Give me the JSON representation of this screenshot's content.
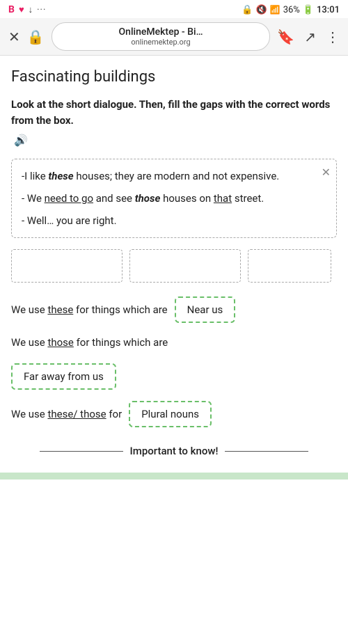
{
  "statusBar": {
    "leftIcons": [
      "B",
      "♥",
      "↓",
      "···"
    ],
    "battery": "36%",
    "time": "13:01",
    "signal": "●●●",
    "wifi": "📶"
  },
  "browser": {
    "urlTitle": "OnlineMektep - Bi…",
    "urlDomain": "onlinemektep.org"
  },
  "page": {
    "title": "Fascinating buildings",
    "instruction": "Look at the short dialogue. Then, fill the gaps with the correct words from the box.",
    "speakerIcon": "🔊",
    "dialogue": [
      {
        "id": 1,
        "text_before": "-I like ",
        "bold_italic": "these",
        "text_after": " houses; they are modern and not expensive."
      },
      {
        "id": 2,
        "text_before": "- We ",
        "underline": "need to go",
        "text_middle": " and see ",
        "bold_italic": "those",
        "text_after": " houses on ",
        "underline2": "that",
        "text_end": " street."
      },
      {
        "id": 3,
        "text": "- Well… you are right."
      }
    ],
    "closeIcon": "✕",
    "useSentences": [
      {
        "id": 1,
        "text_before": "We use ",
        "underline": "these",
        "text_after": " for things which are",
        "answer": "Near us"
      },
      {
        "id": 2,
        "text_before": "We use ",
        "underline": "those",
        "text_after": " for things which are",
        "answer": "Far away from us"
      },
      {
        "id": 3,
        "text_before": "We use ",
        "underline": "these/ those",
        "text_after": " for",
        "answer": "Plural nouns"
      }
    ],
    "importantText": "Important to know!"
  }
}
